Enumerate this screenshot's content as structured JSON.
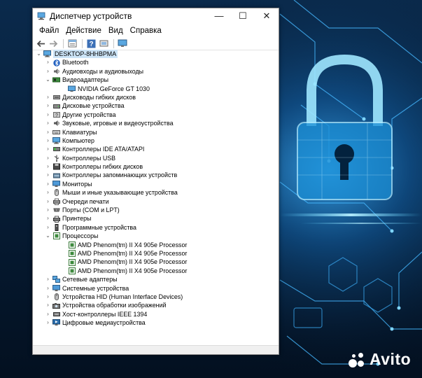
{
  "window": {
    "title": "Диспетчер устройств",
    "minimize_glyph": "—",
    "maximize_glyph": "☐",
    "close_glyph": "✕"
  },
  "menu": [
    "Файл",
    "Действие",
    "Вид",
    "Справка"
  ],
  "toolbar_icons": [
    "back-arrow-icon",
    "forward-arrow-icon",
    "properties-icon",
    "help-icon",
    "update-driver-icon",
    "monitor-scan-icon"
  ],
  "tree": {
    "root": "DESKTOP-8HHBPMA",
    "items": [
      {
        "label": "Bluetooth",
        "icon": "bluetooth-icon",
        "expanded": false
      },
      {
        "label": "Аудиовходы и аудиовыходы",
        "icon": "speaker-icon",
        "expanded": false
      },
      {
        "label": "Видеоадаптеры",
        "icon": "display-adapter-icon",
        "expanded": true,
        "children": [
          "NVIDIA GeForce GT 1030"
        ]
      },
      {
        "label": "Дисководы гибких дисков",
        "icon": "floppy-drive-icon",
        "expanded": false
      },
      {
        "label": "Дисковые устройства",
        "icon": "disk-drive-icon",
        "expanded": false
      },
      {
        "label": "Другие устройства",
        "icon": "unknown-device-icon",
        "expanded": false
      },
      {
        "label": "Звуковые, игровые и видеоустройства",
        "icon": "sound-icon",
        "expanded": false
      },
      {
        "label": "Клавиатуры",
        "icon": "keyboard-icon",
        "expanded": false
      },
      {
        "label": "Компьютер",
        "icon": "computer-icon",
        "expanded": false
      },
      {
        "label": "Контроллеры IDE ATA/ATAPI",
        "icon": "ide-controller-icon",
        "expanded": false
      },
      {
        "label": "Контроллеры USB",
        "icon": "usb-icon",
        "expanded": false
      },
      {
        "label": "Контроллеры гибких дисков",
        "icon": "floppy-controller-icon",
        "expanded": false
      },
      {
        "label": "Контроллеры запоминающих устройств",
        "icon": "storage-controller-icon",
        "expanded": false
      },
      {
        "label": "Мониторы",
        "icon": "monitor-icon",
        "expanded": false
      },
      {
        "label": "Мыши и иные указывающие устройства",
        "icon": "mouse-icon",
        "expanded": false
      },
      {
        "label": "Очереди печати",
        "icon": "print-queue-icon",
        "expanded": false
      },
      {
        "label": "Порты (COM и LPT)",
        "icon": "port-icon",
        "expanded": false
      },
      {
        "label": "Принтеры",
        "icon": "printer-icon",
        "expanded": false
      },
      {
        "label": "Программные устройства",
        "icon": "software-device-icon",
        "expanded": false
      },
      {
        "label": "Процессоры",
        "icon": "processor-icon",
        "expanded": true,
        "children": [
          "AMD Phenom(tm) II X4 905e Processor",
          "AMD Phenom(tm) II X4 905e Processor",
          "AMD Phenom(tm) II X4 905e Processor",
          "AMD Phenom(tm) II X4 905e Processor"
        ]
      },
      {
        "label": "Сетевые адаптеры",
        "icon": "network-adapter-icon",
        "expanded": false
      },
      {
        "label": "Системные устройства",
        "icon": "system-device-icon",
        "expanded": false
      },
      {
        "label": "Устройства HID (Human Interface Devices)",
        "icon": "hid-icon",
        "expanded": false
      },
      {
        "label": "Устройства обработки изображений",
        "icon": "camera-icon",
        "expanded": false
      },
      {
        "label": "Хост-контроллеры IEEE 1394",
        "icon": "ieee1394-icon",
        "expanded": false
      },
      {
        "label": "Цифровые медиаустройства",
        "icon": "media-device-icon",
        "expanded": false
      }
    ]
  },
  "watermark": {
    "brand": "Avito"
  },
  "colors": {
    "background_dark": "#041428",
    "background_glow": "#1e8fd8",
    "window_bg": "#ffffff",
    "selection": "#cce4f7"
  }
}
